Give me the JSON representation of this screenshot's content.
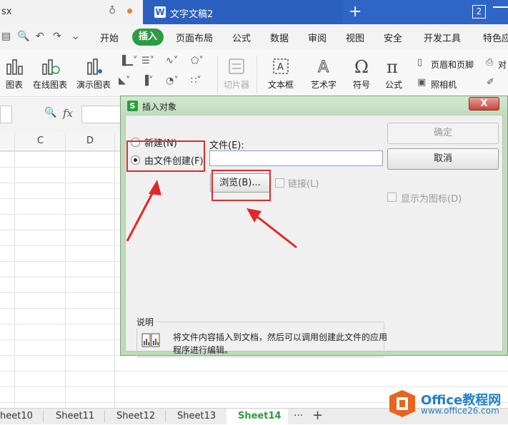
{
  "titlebar": {
    "prev_tab_label": "sx",
    "doc_tab_label": "文字文稿2",
    "window_count": "2",
    "doc_icon_letter": "W",
    "accent_color": "#2f65c6"
  },
  "menu": {
    "items": [
      "开始",
      "插入",
      "页面布局",
      "公式",
      "数据",
      "审阅",
      "视图",
      "安全",
      "开发工具",
      "特色应"
    ],
    "active": "插入",
    "active_color": "#2d9b41"
  },
  "ribbon": {
    "chart_label": "图表",
    "online_chart_label": "在线图表",
    "demo_chart_label": "演示图表",
    "slicer_label": "切片器",
    "textbox_label": "文本框",
    "wordart_label": "艺术字",
    "symbol_label": "符号",
    "formula_label": "公式",
    "header_footer_label": "页眉和页脚",
    "camera_label": "照相机",
    "object_label": "对"
  },
  "formula_bar": {
    "fx_label": "fx"
  },
  "sheet": {
    "columns": [
      "C",
      "D"
    ],
    "tabs": [
      "heet10",
      "Sheet11",
      "Sheet12",
      "Sheet13",
      "Sheet14"
    ],
    "active_tab": "Sheet14",
    "more_label": "···",
    "add_label": "+"
  },
  "dialog": {
    "title": "插入对象",
    "radio_new_label": "新建(N)",
    "radio_from_file_label": "由文件创建(F)",
    "selected_option": "由文件创建(F)",
    "file_label": "文件(E):",
    "file_value": "",
    "browse_label": "浏览(B)...",
    "link_label": "链接(L)",
    "ok_label": "确定",
    "cancel_label": "取消",
    "display_as_icon_label": "显示为图标(D)",
    "description_title": "说明",
    "description_text": "将文件内容插入到文档，然后可以调用创建此文件的应用程序进行编辑。",
    "close_label": "X"
  },
  "watermark": {
    "title": "Office教程网",
    "url": "www.office26.com"
  }
}
